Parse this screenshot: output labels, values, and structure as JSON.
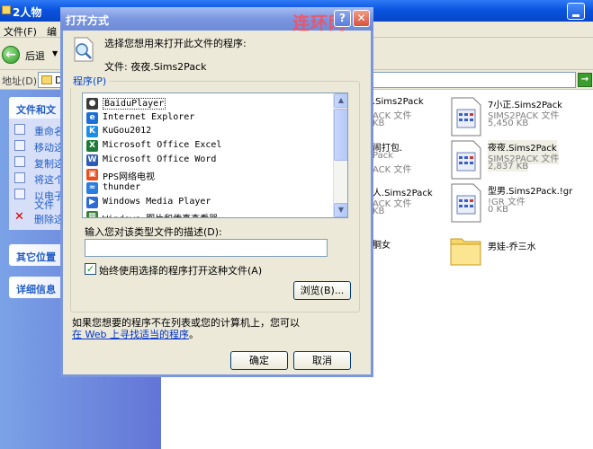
{
  "explorer": {
    "title": "2人物",
    "menu": [
      "文件(F)",
      "编"
    ],
    "toolbar": {
      "back_label": "后退"
    },
    "address": {
      "label": "地址(D)",
      "value": "D"
    },
    "tasks_panel": {
      "header": "文件和文",
      "items": [
        "重命名",
        "移动这",
        "复制这",
        "将这个",
        "以电子",
        "删除这"
      ],
      "item_extra": "文件"
    },
    "other_places": "其它位置",
    "details": "详细信息",
    "files": [
      {
        "name": ".Sims2Pack",
        "type": "ACK 文件",
        "size": "KB"
      },
      {
        "name": "7小正.Sims2Pack",
        "type": "SIMS2PACK 文件",
        "size": "5,450 KB"
      },
      {
        "name": "闹打包.",
        "type": "Pack",
        "size": "ACK 文件"
      },
      {
        "name": "夜夜.Sims2Pack",
        "type": "SIMS2PACK 文件",
        "size": "2,837 KB"
      },
      {
        "name": "人.Sims2Pack",
        "type": "ACK 文件",
        "size": "KB"
      },
      {
        "name": "型男.Sims2Pack.!gr",
        "type": "!GR 文件",
        "size": "0 KB"
      },
      {
        "name": "胴女",
        "type": "",
        "size": ""
      },
      {
        "name": "男娃-乔三水",
        "type": "",
        "size": ""
      }
    ]
  },
  "dialog": {
    "title": "打开方式",
    "watermark": "连环网",
    "help": "?",
    "close": "✕",
    "prompt": "选择您想用来打开此文件的程序:",
    "file_line": "文件: 夜夜.Sims2Pack",
    "programs_label": "程序(P)",
    "programs": [
      {
        "name": "BaiduPlayer",
        "icon": "baiduplayer-icon",
        "color": "#3a3a3a"
      },
      {
        "name": "Internet Explorer",
        "icon": "internet-explorer-icon",
        "color": "#1b6fd6"
      },
      {
        "name": "KuGou2012",
        "icon": "kugou-icon",
        "color": "#1a8ee6"
      },
      {
        "name": "Microsoft Office Excel",
        "icon": "excel-icon",
        "color": "#1d7a3a"
      },
      {
        "name": "Microsoft Office Word",
        "icon": "word-icon",
        "color": "#2b5bb8"
      },
      {
        "name": "PPS网络电视",
        "icon": "pps-icon",
        "color": "#e8501e"
      },
      {
        "name": "thunder",
        "icon": "thunder-icon",
        "color": "#2a7de1"
      },
      {
        "name": "Windows Media Player",
        "icon": "media-player-icon",
        "color": "#2d6ad6"
      },
      {
        "name": "Windows 图片和传真查看器",
        "icon": "picture-viewer-icon",
        "color": "#3c7e3c"
      }
    ],
    "selected_program_index": 0,
    "desc_label": "输入您对该类型文件的描述(D):",
    "desc_value": "",
    "always_use_label": "始终使用选择的程序打开这种文件(A)",
    "always_use_checked": true,
    "browse_label": "浏览(B)...",
    "note_line1": "如果您想要的程序不在列表或您的计算机上，您可以",
    "note_link": "在 Web 上寻找适当的程序",
    "note_end": "。",
    "ok_label": "确定",
    "cancel_label": "取消"
  }
}
